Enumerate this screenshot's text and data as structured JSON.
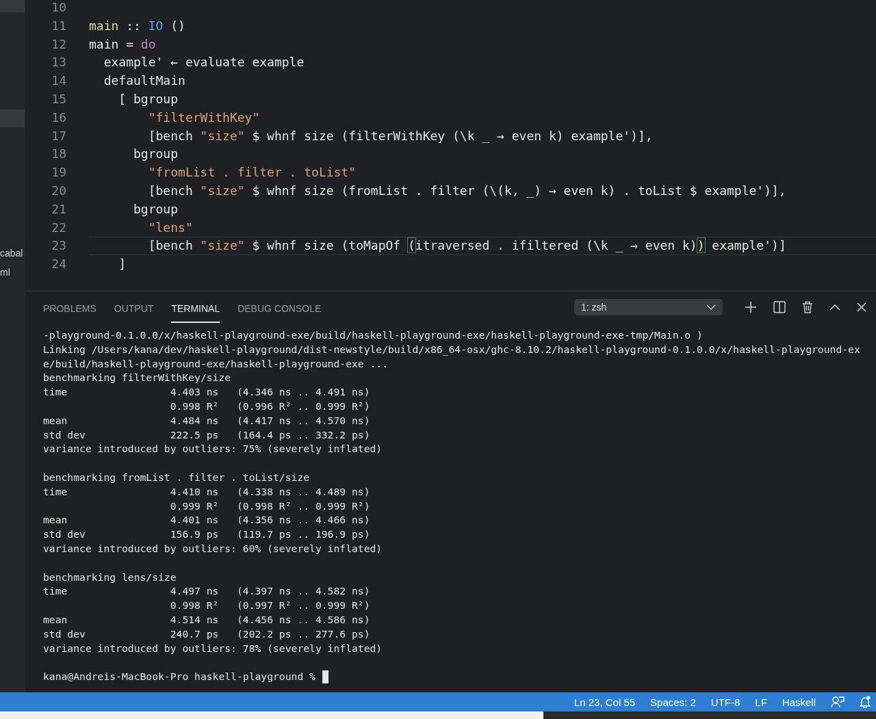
{
  "sidebar": {
    "items": [
      {
        "selected": true
      },
      {
        "selected": true
      },
      {
        "label": "cabal",
        "selected": false
      },
      {
        "label": "ml",
        "selected": false
      }
    ]
  },
  "editor": {
    "lines": [
      {
        "number": "10",
        "current": false
      },
      {
        "number": "11",
        "current": false,
        "tokens": [
          {
            "text": "main",
            "kind": "func"
          },
          {
            "text": " :: ",
            "kind": "plain"
          },
          {
            "text": "IO",
            "kind": "type"
          },
          {
            "text": " ()",
            "kind": "plain"
          }
        ]
      },
      {
        "number": "12",
        "current": false,
        "tokens": [
          {
            "text": "main = ",
            "kind": "plain"
          },
          {
            "text": "do",
            "kind": "keyword"
          }
        ]
      },
      {
        "number": "13",
        "current": false,
        "tokens": [
          {
            "text": "  example' ← evaluate example",
            "kind": "plain"
          }
        ]
      },
      {
        "number": "14",
        "current": false,
        "tokens": [
          {
            "text": "  defaultMain",
            "kind": "plain"
          }
        ]
      },
      {
        "number": "15",
        "current": false,
        "tokens": [
          {
            "text": "    [ bgroup",
            "kind": "plain"
          }
        ]
      },
      {
        "number": "16",
        "current": false,
        "tokens": [
          {
            "text": "        \"filterWithKey\"",
            "kind": "string"
          }
        ]
      },
      {
        "number": "17",
        "current": false,
        "tokens": [
          {
            "text": "        [bench ",
            "kind": "plain"
          },
          {
            "text": "\"size\"",
            "kind": "string"
          },
          {
            "text": " $ whnf size (filterWithKey (\\k _ → even k) example')],",
            "kind": "plain"
          }
        ]
      },
      {
        "number": "18",
        "current": false,
        "tokens": [
          {
            "text": "      bgroup",
            "kind": "plain"
          }
        ]
      },
      {
        "number": "19",
        "current": false,
        "tokens": [
          {
            "text": "        \"fromList . filter . toList\"",
            "kind": "string"
          }
        ]
      },
      {
        "number": "20",
        "current": false,
        "tokens": [
          {
            "text": "        [bench ",
            "kind": "plain"
          },
          {
            "text": "\"size\"",
            "kind": "string"
          },
          {
            "text": " $ whnf size (fromList . filter (\\(k, _) → even k) . toList $ example')],",
            "kind": "plain"
          }
        ]
      },
      {
        "number": "21",
        "current": false,
        "tokens": [
          {
            "text": "      bgroup",
            "kind": "plain"
          }
        ]
      },
      {
        "number": "22",
        "current": false,
        "tokens": [
          {
            "text": "        \"lens\"",
            "kind": "string"
          }
        ]
      },
      {
        "number": "23",
        "current": true,
        "tokens": [
          {
            "text": "        [bench ",
            "kind": "plain"
          },
          {
            "text": "\"size\"",
            "kind": "string"
          },
          {
            "text": " $ whnf size (toMapOf ",
            "kind": "plain"
          },
          {
            "text": "(",
            "kind": "bracket"
          },
          {
            "text": "itraversed . ifiltered (\\k _ → even k)",
            "kind": "plain"
          },
          {
            "text": ")",
            "kind": "bracket"
          },
          {
            "text": " example')]",
            "kind": "plain"
          }
        ]
      },
      {
        "number": "24",
        "current": false,
        "tokens": [
          {
            "text": "    ]",
            "kind": "plain"
          }
        ]
      }
    ]
  },
  "panel": {
    "tabs": [
      {
        "label": "PROBLEMS",
        "selected": false
      },
      {
        "label": "OUTPUT",
        "selected": false
      },
      {
        "label": "TERMINAL",
        "selected": true
      },
      {
        "label": "DEBUG CONSOLE",
        "selected": false
      }
    ],
    "terminal_select": {
      "value": "1: zsh"
    },
    "terminal": {
      "blocks": [
        [
          "-playground-0.1.0.0/x/haskell-playground-exe/build/haskell-playground-exe/haskell-playground-exe-tmp/Main.o )",
          "Linking /Users/kana/dev/haskell-playground/dist-newstyle/build/x86_64-osx/ghc-8.10.2/haskell-playground-0.1.0.0/x/haskell-playground-ex",
          "e/build/haskell-playground-exe/haskell-playground-exe ...",
          "benchmarking filterWithKey/size",
          "time                 4.403 ns   (4.346 ns .. 4.491 ns)",
          "                     0.998 R²   (0.996 R² .. 0.999 R²)",
          "mean                 4.484 ns   (4.417 ns .. 4.570 ns)",
          "std dev              222.5 ps   (164.4 ps .. 332.2 ps)",
          "variance introduced by outliers: 75% (severely inflated)"
        ],
        [
          "benchmarking fromList . filter . toList/size",
          "time                 4.410 ns   (4.338 ns .. 4.489 ns)",
          "                     0.999 R²   (0.998 R² .. 0.999 R²)",
          "mean                 4.401 ns   (4.356 ns .. 4.466 ns)",
          "std dev              156.9 ps   (119.7 ps .. 196.9 ps)",
          "variance introduced by outliers: 60% (severely inflated)"
        ],
        [
          "benchmarking lens/size",
          "time                 4.497 ns   (4.397 ns .. 4.582 ns)",
          "                     0.998 R²   (0.997 R² .. 0.999 R²)",
          "mean                 4.514 ns   (4.456 ns .. 4.586 ns)",
          "std dev              240.7 ps   (202.2 ps .. 277.6 ps)",
          "variance introduced by outliers: 78% (severely inflated)"
        ]
      ],
      "prompt": "kana@Andreis-MacBook-Pro haskell-playground %"
    }
  },
  "status_bar": {
    "items": [
      "Ln 23, Col 55",
      "Spaces: 2",
      "UTF-8",
      "LF",
      "Haskell"
    ]
  }
}
